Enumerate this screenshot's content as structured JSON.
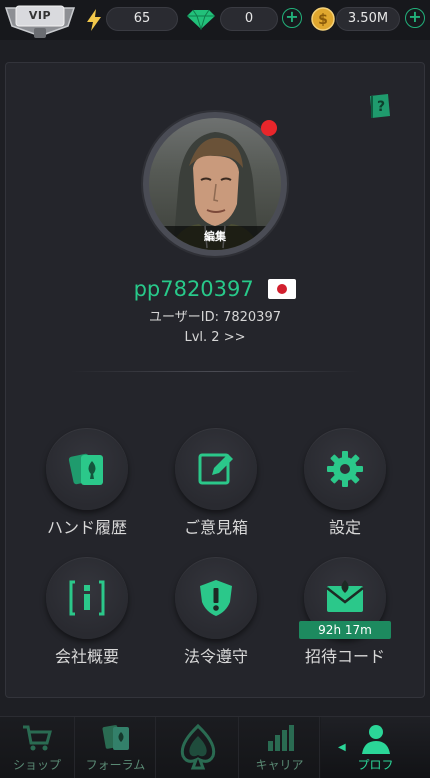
{
  "topbar": {
    "vip_label": "VIP",
    "energy_value": "65",
    "gems_value": "0",
    "coins_value": "3.50M"
  },
  "profile": {
    "edit_label": "編集",
    "username": "pp7820397",
    "user_id": "ユーザーID: 7820397",
    "level": "Lvl. 2 >>"
  },
  "menu": {
    "hand_history": "ハンド履歴",
    "feedback": "ご意見箱",
    "settings": "設定",
    "company": "会社概要",
    "compliance": "法令遵守",
    "invite_code": "招待コード",
    "invite_timer": "92h 17m"
  },
  "nav": {
    "shop": "ショップ",
    "forum": "フォーラム",
    "career": "キャリア",
    "profile": "プロフ"
  },
  "colors": {
    "accent": "#28c98a",
    "background": "#1e1f24",
    "notification": "#e8262b"
  }
}
